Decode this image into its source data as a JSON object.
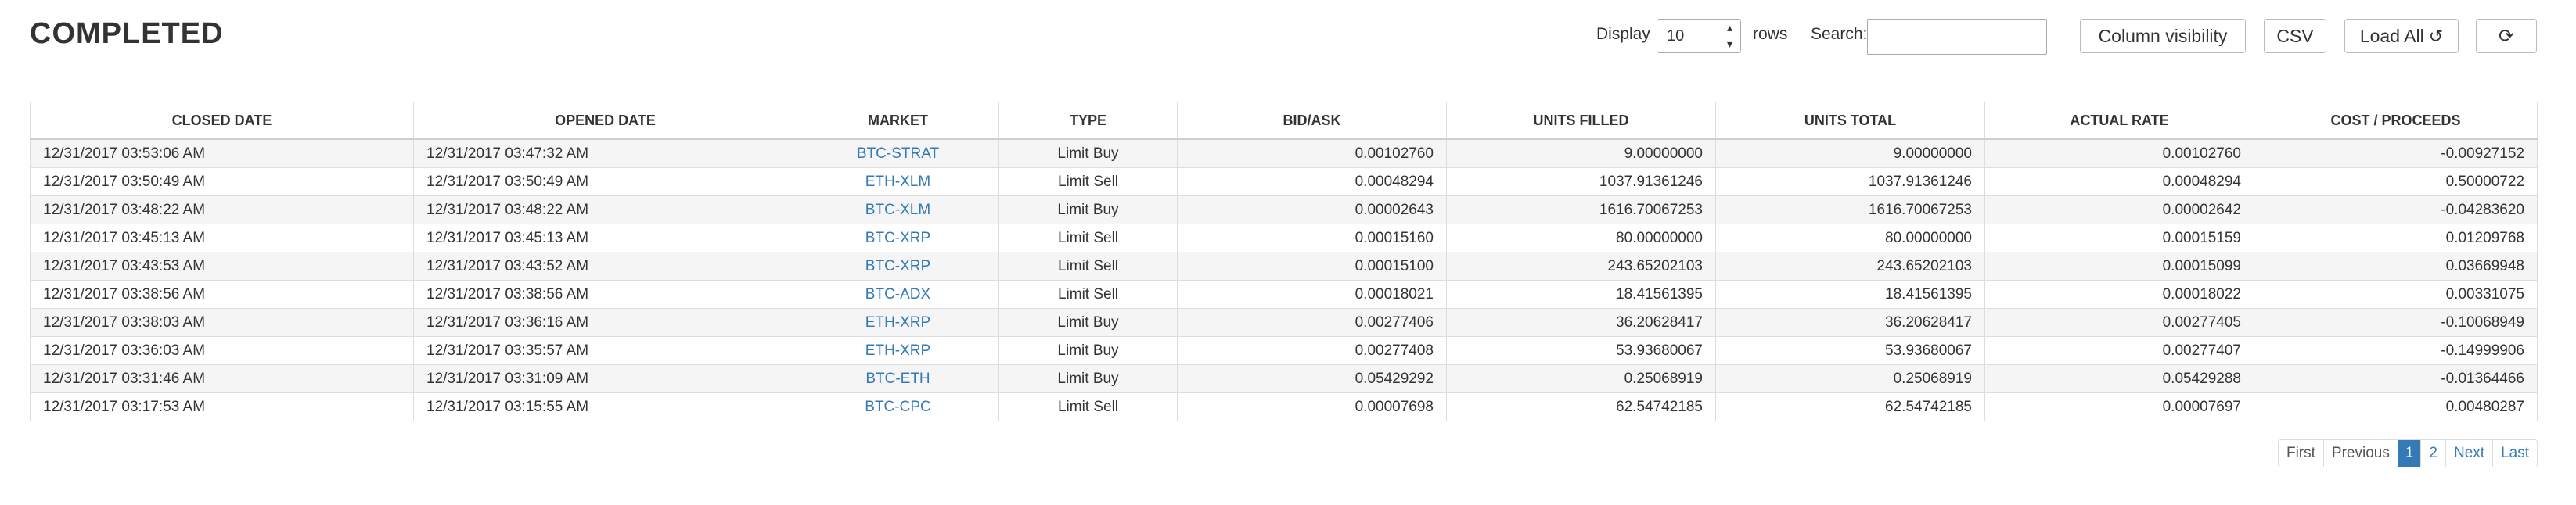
{
  "page": {
    "title": "COMPLETED"
  },
  "controls": {
    "display_label": "Display",
    "rows_value": "10",
    "rows_label": "rows",
    "search_label": "Search:",
    "search_value": ""
  },
  "buttons": {
    "column_visibility": "Column visibility",
    "csv": "CSV",
    "load_all": "Load All",
    "load_all_icon": "history-icon",
    "refresh_icon": "refresh-icon"
  },
  "table": {
    "columns": [
      "CLOSED DATE",
      "OPENED DATE",
      "MARKET",
      "TYPE",
      "BID/ASK",
      "UNITS FILLED",
      "UNITS TOTAL",
      "ACTUAL RATE",
      "COST / PROCEEDS"
    ],
    "rows": [
      [
        "12/31/2017 03:53:06 AM",
        "12/31/2017 03:47:32 AM",
        "BTC-STRAT",
        "Limit Buy",
        "0.00102760",
        "9.00000000",
        "9.00000000",
        "0.00102760",
        "-0.00927152"
      ],
      [
        "12/31/2017 03:50:49 AM",
        "12/31/2017 03:50:49 AM",
        "ETH-XLM",
        "Limit Sell",
        "0.00048294",
        "1037.91361246",
        "1037.91361246",
        "0.00048294",
        "0.50000722"
      ],
      [
        "12/31/2017 03:48:22 AM",
        "12/31/2017 03:48:22 AM",
        "BTC-XLM",
        "Limit Buy",
        "0.00002643",
        "1616.70067253",
        "1616.70067253",
        "0.00002642",
        "-0.04283620"
      ],
      [
        "12/31/2017 03:45:13 AM",
        "12/31/2017 03:45:13 AM",
        "BTC-XRP",
        "Limit Sell",
        "0.00015160",
        "80.00000000",
        "80.00000000",
        "0.00015159",
        "0.01209768"
      ],
      [
        "12/31/2017 03:43:53 AM",
        "12/31/2017 03:43:52 AM",
        "BTC-XRP",
        "Limit Sell",
        "0.00015100",
        "243.65202103",
        "243.65202103",
        "0.00015099",
        "0.03669948"
      ],
      [
        "12/31/2017 03:38:56 AM",
        "12/31/2017 03:38:56 AM",
        "BTC-ADX",
        "Limit Sell",
        "0.00018021",
        "18.41561395",
        "18.41561395",
        "0.00018022",
        "0.00331075"
      ],
      [
        "12/31/2017 03:38:03 AM",
        "12/31/2017 03:36:16 AM",
        "ETH-XRP",
        "Limit Buy",
        "0.00277406",
        "36.20628417",
        "36.20628417",
        "0.00277405",
        "-0.10068949"
      ],
      [
        "12/31/2017 03:36:03 AM",
        "12/31/2017 03:35:57 AM",
        "ETH-XRP",
        "Limit Buy",
        "0.00277408",
        "53.93680067",
        "53.93680067",
        "0.00277407",
        "-0.14999906"
      ],
      [
        "12/31/2017 03:31:46 AM",
        "12/31/2017 03:31:09 AM",
        "BTC-ETH",
        "Limit Buy",
        "0.05429292",
        "0.25068919",
        "0.25068919",
        "0.05429288",
        "-0.01364466"
      ],
      [
        "12/31/2017 03:17:53 AM",
        "12/31/2017 03:15:55 AM",
        "BTC-CPC",
        "Limit Sell",
        "0.00007698",
        "62.54742185",
        "62.54742185",
        "0.00007697",
        "0.00480287"
      ]
    ]
  },
  "pagination": {
    "first": "First",
    "previous": "Previous",
    "pages": [
      "1",
      "2"
    ],
    "current": "1",
    "next": "Next",
    "last": "Last"
  }
}
